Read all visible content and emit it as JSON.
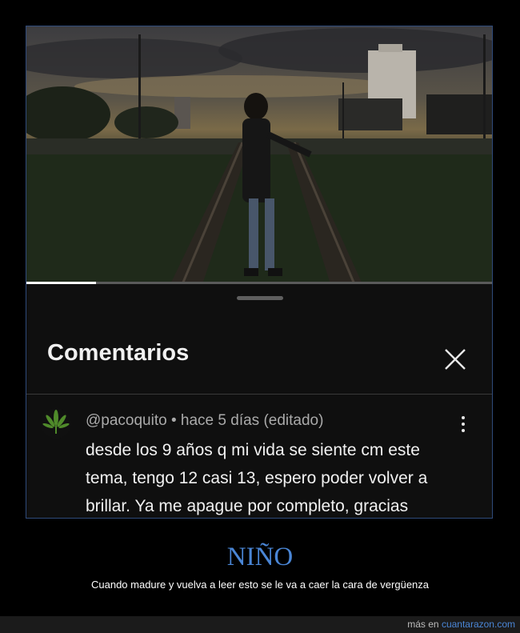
{
  "video": {
    "progress_fraction": 0.15,
    "description_icon": "video-frame"
  },
  "comments_sheet": {
    "title": "Comentarios",
    "close_icon": "close-icon"
  },
  "comment": {
    "author": "@pacoquito",
    "separator": "•",
    "time": "hace 5 días (editado)",
    "text": "desde los 9 años q mi vida se siente cm este tema, tengo 12 casi 13, espero poder volver a brillar. Ya me apague por completo, gracias amigos.",
    "avatar_icon": "cannabis-leaf-icon"
  },
  "post": {
    "headline": "NIÑO",
    "caption": "Cuando madure y vuelva a leer esto se le va a caer la cara de vergüenza"
  },
  "footer": {
    "prefix": "más en ",
    "link": "cuantarazon.com"
  },
  "colors": {
    "background": "#000000",
    "accent": "#4a86d6",
    "sheet": "#0f0f0f"
  }
}
